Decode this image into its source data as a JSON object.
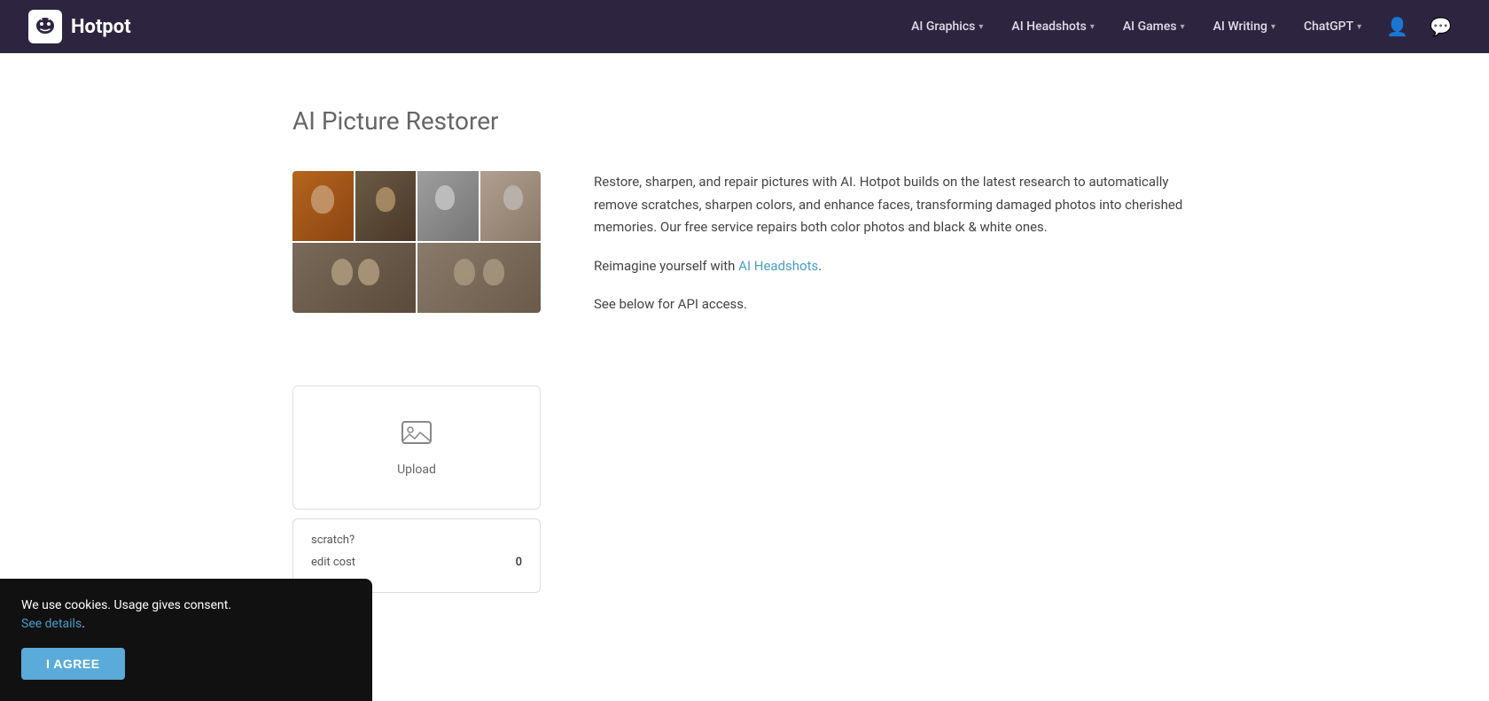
{
  "nav": {
    "logo_text": "Hotpot",
    "items": [
      {
        "label": "AI Graphics",
        "id": "ai-graphics"
      },
      {
        "label": "AI Headshots",
        "id": "ai-headshots"
      },
      {
        "label": "AI Games",
        "id": "ai-games"
      },
      {
        "label": "AI Writing",
        "id": "ai-writing"
      },
      {
        "label": "ChatGPT",
        "id": "chatgpt"
      }
    ]
  },
  "page": {
    "title": "AI Picture Restorer"
  },
  "description": {
    "paragraph1": "Restore, sharpen, and repair pictures with AI. Hotpot builds on the latest research to automatically remove scratches, sharpen colors, and enhance faces, transforming damaged photos into cherished memories. Our free service repairs both color photos and black & white ones.",
    "paragraph2_prefix": "Reimagine yourself with ",
    "paragraph2_link": "AI Headshots",
    "paragraph2_suffix": ".",
    "paragraph3": "See below for API access."
  },
  "upload": {
    "label": "Upload"
  },
  "form": {
    "scratch_label": "scratch?",
    "credit_label": "edit cost",
    "credit_value": "0"
  },
  "cookie": {
    "text": "We use cookies. Usage gives consent.",
    "details_link": "See details",
    "agree_button": "I AGREE"
  }
}
